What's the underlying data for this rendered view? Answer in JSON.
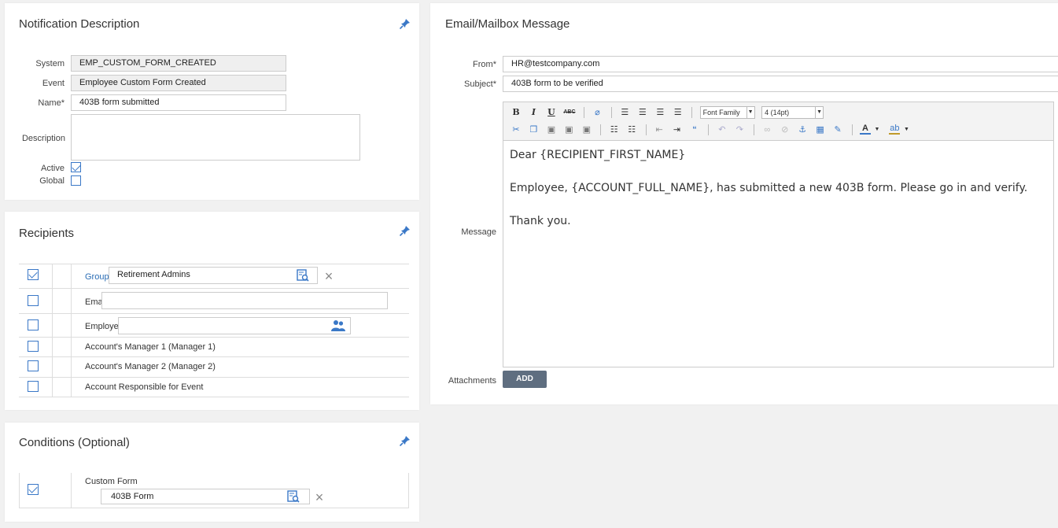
{
  "notification": {
    "title": "Notification Description",
    "system_label": "System",
    "system_value": "EMP_CUSTOM_FORM_CREATED",
    "event_label": "Event",
    "event_value": "Employee Custom Form Created",
    "name_label": "Name*",
    "name_value": "403B form submitted",
    "description_label": "Description",
    "description_value": "",
    "active_label": "Active",
    "active_checked": true,
    "global_label": "Global",
    "global_checked": false
  },
  "recipients": {
    "title": "Recipients",
    "rows": [
      {
        "checked": true,
        "label": "Group:",
        "value": "Retirement Admins"
      },
      {
        "checked": false,
        "label": "Email",
        "value": ""
      },
      {
        "checked": false,
        "label": "Employee",
        "value": ""
      },
      {
        "checked": false,
        "label": "Account's Manager 1 (Manager 1)"
      },
      {
        "checked": false,
        "label": "Account's Manager 2 (Manager 2)"
      },
      {
        "checked": false,
        "label": "Account Responsible for Event"
      }
    ]
  },
  "conditions": {
    "title": "Conditions (Optional)",
    "checked": true,
    "label": "Custom Form",
    "value": "403B Form"
  },
  "email": {
    "title": "Email/Mailbox Message",
    "from_label": "From*",
    "from_value": "HR@testcompany.com",
    "subject_label": "Subject*",
    "subject_value": "403B form to be verified",
    "message_label": "Message",
    "font_family_select": "Font Family",
    "font_size_select": "4 (14pt)",
    "message_lines": [
      "Dear {RECIPIENT_FIRST_NAME}",
      "Employee, {ACCOUNT_FULL_NAME}, has submitted a new 403B form.  Please go in and verify.",
      "Thank you."
    ],
    "attachments_label": "Attachments",
    "add_button": "ADD"
  },
  "colors": {
    "accent_blue": "#3a78c7",
    "group_label_blue": "#2a6db5",
    "add_button_bg": "#5f6e80"
  },
  "icons": {
    "pin": "pin-icon",
    "lookup": "lookup-search-icon",
    "employee": "people-icon",
    "remove": "close-icon"
  }
}
